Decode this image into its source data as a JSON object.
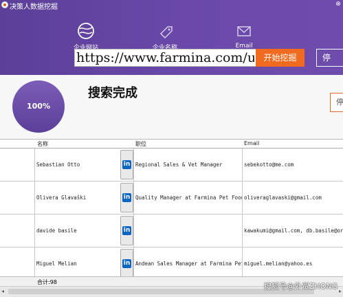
{
  "app": {
    "title": "决策人数据挖掘",
    "close_label": "⊗"
  },
  "tabs": [
    {
      "label": "企业网站",
      "icon": "globe-icon"
    },
    {
      "label": "企业名称",
      "icon": "tag-icon"
    },
    {
      "label": "Email",
      "icon": "mail-icon"
    }
  ],
  "search": {
    "url_value": "https://www.farmina.com/us",
    "start_button": "开始挖掘",
    "stop_button": "停"
  },
  "status": {
    "progress": "100%",
    "progress_value": 1.0,
    "title": "搜索完成",
    "side_button": "停"
  },
  "table": {
    "headers": [
      "名称",
      "职位",
      "Email"
    ],
    "rows": [
      {
        "name": "Sebastian Otto",
        "position": "Regional Sales & Vet Manager",
        "email": "sebekotto@me.com"
      },
      {
        "name": "Olivera Glavaški",
        "position": "Quality Manager at Farmina Pet Foods",
        "email": "oliveraglavaski@gmail.com"
      },
      {
        "name": "davide basile",
        "position": "",
        "email": "kawakumi@gmail.com, db.basile@origi"
      },
      {
        "name": "Miguel Melian",
        "position": "Andean Sales Manager at Farmina Pet",
        "email": "miguel.melian@yahoo.es"
      }
    ],
    "linkedin_label": "in",
    "total": "合计:98"
  },
  "scrollbar": {
    "left": "◂",
    "right": "▸"
  },
  "watermark": "搜狐号@外贸ZHONG",
  "colors": {
    "header": "#5b3f99",
    "accent": "#f06a1f",
    "linkedin": "#0a66c2"
  }
}
